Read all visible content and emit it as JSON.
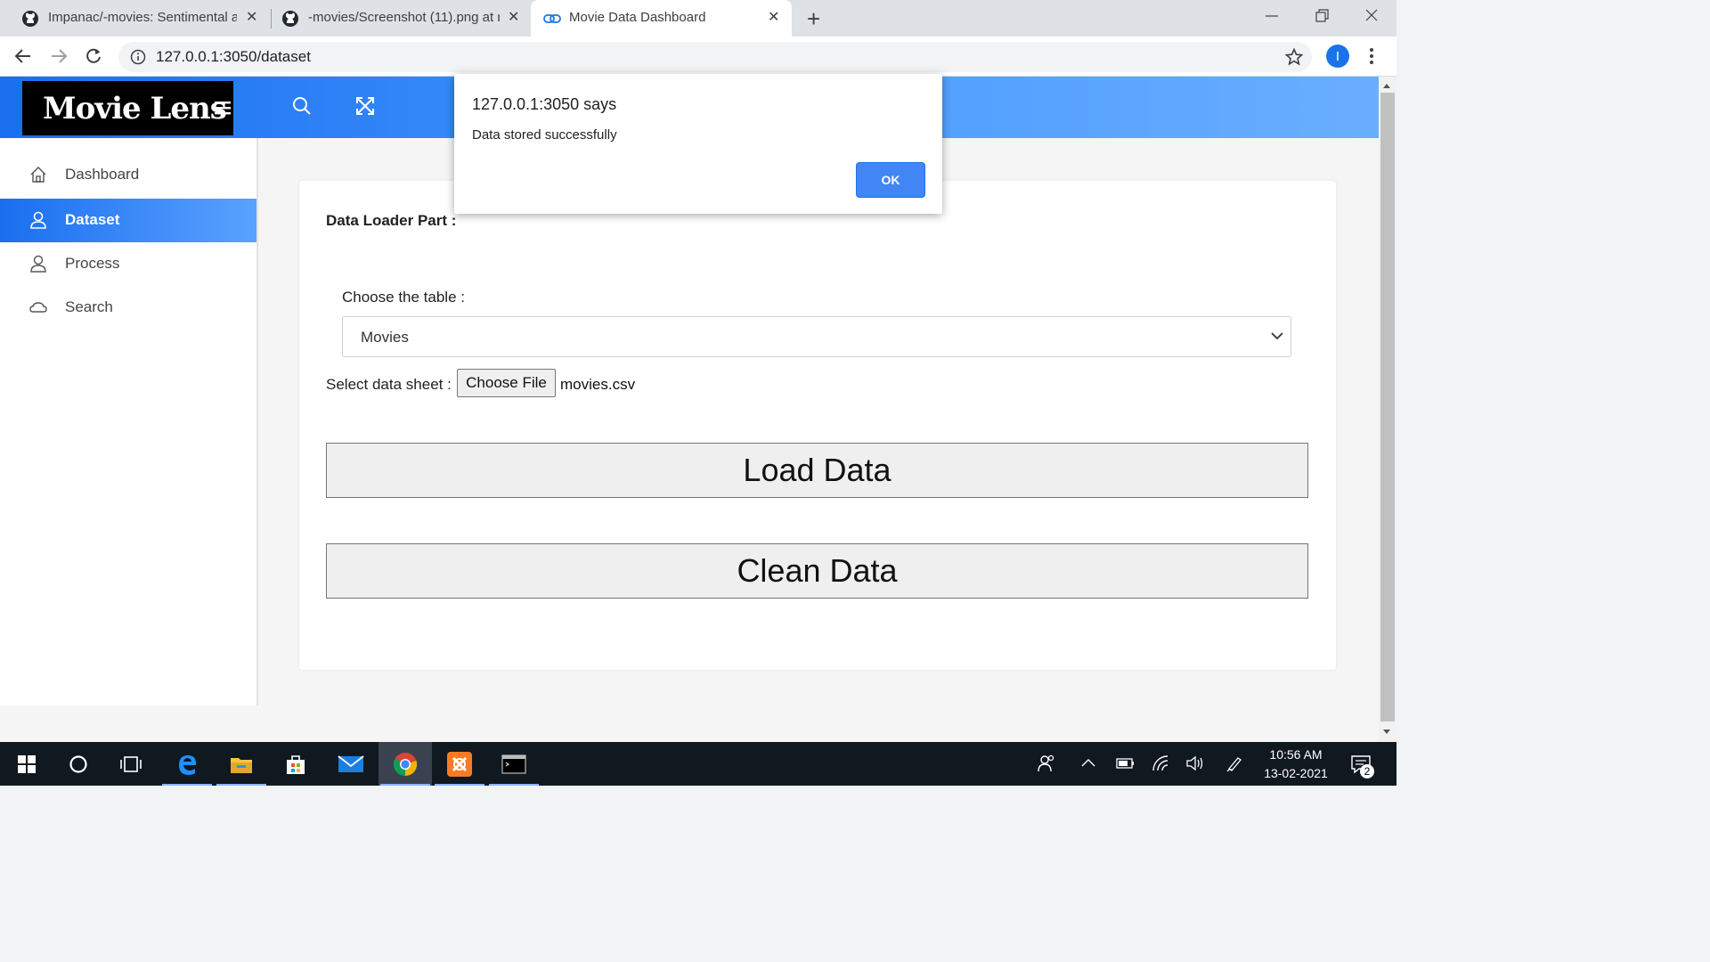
{
  "browser": {
    "tabs": [
      {
        "title": "Impanac/-movies: Sentimental an"
      },
      {
        "title": "-movies/Screenshot (11).png at m"
      },
      {
        "title": "Movie Data Dashboard"
      }
    ],
    "url": "127.0.0.1:3050/dataset",
    "profile_initial": "I"
  },
  "app": {
    "logo": "Movie Lens",
    "nav": [
      {
        "label": "Dashboard",
        "icon": "home-icon"
      },
      {
        "label": "Dataset",
        "icon": "user-icon",
        "active": true
      },
      {
        "label": "Process",
        "icon": "user-icon"
      },
      {
        "label": "Search",
        "icon": "cloud-icon"
      }
    ],
    "card": {
      "title": "Data Loader Part :",
      "table_label": "Choose the table :",
      "selected_table": "Movies",
      "sheet_label": "Select data sheet :",
      "file_button": "Choose File",
      "file_name": "movies.csv",
      "load_button": "Load Data",
      "clean_button": "Clean Data"
    }
  },
  "dialog": {
    "title": "127.0.0.1:3050 says",
    "message": "Data stored successfully",
    "ok": "OK"
  },
  "taskbar": {
    "time": "10:56 AM",
    "date": "13-02-2021",
    "notification_count": "2"
  },
  "colors": {
    "accent": "#1a73e8",
    "header_gradient_start": "#1a6ff0",
    "header_gradient_end": "#6aaeff",
    "taskbar": "#101820"
  }
}
